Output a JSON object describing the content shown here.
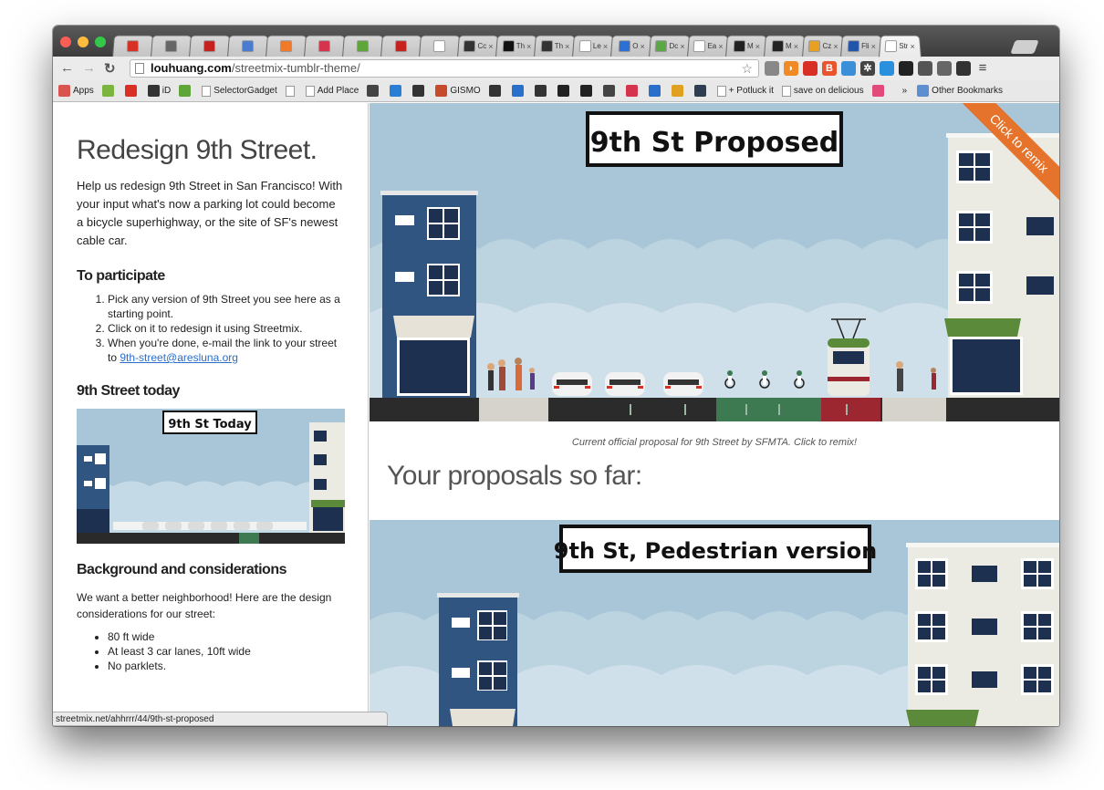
{
  "browser": {
    "tabs": [
      {
        "text": "",
        "color": "#d93025"
      },
      {
        "text": "",
        "color": "#666666"
      },
      {
        "text": "",
        "color": "#c5221f"
      },
      {
        "text": "",
        "color": "#4a7bd0"
      },
      {
        "text": "",
        "color": "#f07a2a"
      },
      {
        "text": "",
        "color": "#d6334e"
      },
      {
        "text": "",
        "color": "#5fa63a"
      },
      {
        "text": "",
        "color": "#c5221f"
      },
      {
        "text": "",
        "color": "#ffffff"
      },
      {
        "text": "Cc",
        "color": "#333333"
      },
      {
        "text": "Th",
        "color": "#111111"
      },
      {
        "text": "Th",
        "color": "#333333"
      },
      {
        "text": "Le",
        "color": "#ffffff"
      },
      {
        "text": "O",
        "color": "#2c6fd6"
      },
      {
        "text": "Dc",
        "color": "#5aa845"
      },
      {
        "text": "Ea",
        "color": "#ffffff"
      },
      {
        "text": "M",
        "color": "#222222"
      },
      {
        "text": "M",
        "color": "#222222"
      },
      {
        "text": "Cz",
        "color": "#e8a020"
      },
      {
        "text": "Fli",
        "color": "#2255aa"
      },
      {
        "text": "Str",
        "color": "#ffffff"
      }
    ],
    "url_host": "louhuang.com",
    "url_path": "/streetmix-tumblr-theme/",
    "bookmarks": [
      {
        "label": "Apps",
        "color": "#d9534f"
      },
      {
        "label": "",
        "color": "#7bb540"
      },
      {
        "label": "",
        "color": "#d93025"
      },
      {
        "label": "iD",
        "color": "#333333"
      },
      {
        "label": "",
        "color": "#5fa63a"
      },
      {
        "label": "SelectorGadget",
        "color": ""
      },
      {
        "label": "",
        "color": ""
      },
      {
        "label": "Add Place",
        "color": ""
      },
      {
        "label": "",
        "color": "#444444"
      },
      {
        "label": "",
        "color": "#2a7fd4"
      },
      {
        "label": "",
        "color": "#333333"
      },
      {
        "label": "GISMO",
        "color": "#c54b2c"
      },
      {
        "label": "",
        "color": "#333333"
      },
      {
        "label": "",
        "color": "#2a6fc9"
      },
      {
        "label": "",
        "color": "#333333"
      },
      {
        "label": "",
        "color": "#222222"
      },
      {
        "label": "",
        "color": "#222222"
      },
      {
        "label": "",
        "color": "#444444"
      },
      {
        "label": "",
        "color": "#d6334e"
      },
      {
        "label": "",
        "color": "#2a6fc9"
      },
      {
        "label": "",
        "color": "#e0a020"
      },
      {
        "label": "",
        "color": "#2c3e50"
      },
      {
        "label": "+ Potluck it",
        "color": ""
      },
      {
        "label": "save on delicious",
        "color": ""
      },
      {
        "label": "",
        "color": "#e24a7a"
      },
      {
        "label": "»",
        "color": "none"
      },
      {
        "label": "Other Bookmarks",
        "color": "#5b8fd0"
      }
    ]
  },
  "sidebar": {
    "title": "Redesign 9th Street.",
    "intro": "Help us redesign 9th Street in San Francisco! With your input what's now a parking lot could become a bicycle superhighway, or the site of SF's newest cable car.",
    "participate_heading": "To participate",
    "steps": [
      "Pick any version of 9th Street you see here as a starting point.",
      "Click on it to redesign it using Streetmix.",
      "When you're done, e-mail the link to your street to"
    ],
    "email": "9th-street@aresluna.org",
    "today_heading": "9th Street today",
    "today_sign": "9th St Today",
    "background_heading": "Background and considerations",
    "background_intro": "We want a better neighborhood! Here are the design considerations for our street:",
    "considerations": [
      "80 ft wide",
      "At least 3 car lanes, 10ft wide",
      "No parklets."
    ]
  },
  "status_url": "streetmix.net/ahhrrr/44/9th-st-proposed",
  "main": {
    "proposed_sign": "9th St Proposed",
    "remix_ribbon": "Click to remix",
    "caption": "Current official proposal for 9th Street by SFMTA. Click to remix!",
    "proposals_heading": "Your proposals so far:",
    "pedestrian_sign": "9th St, Pedestrian version"
  },
  "colors": {
    "sky": "#a9c6d8",
    "building_blue": "#2f5580",
    "ribbon": "#e5732b",
    "bike_lane": "#3d7a52",
    "transit_lane": "#9c2730"
  }
}
